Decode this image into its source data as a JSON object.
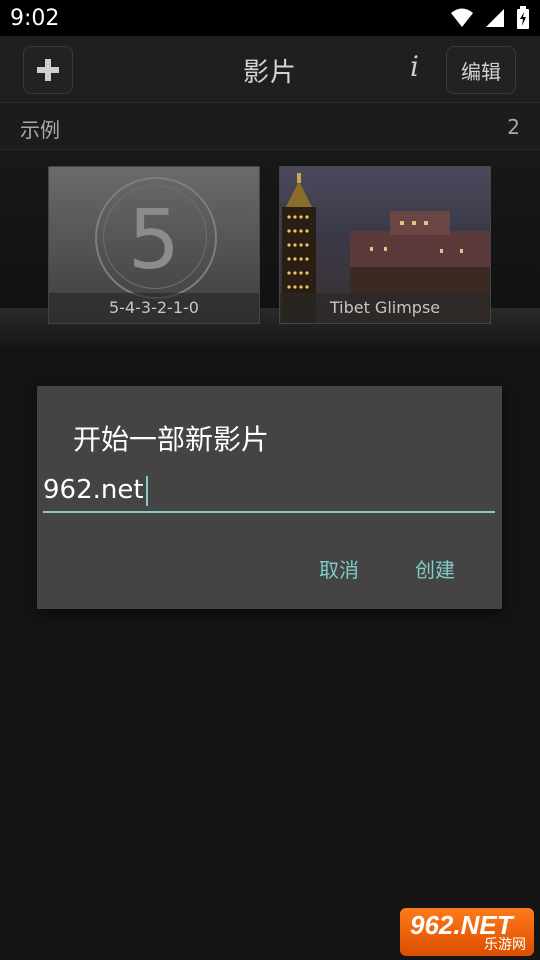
{
  "status_bar": {
    "time": "9:02"
  },
  "toolbar": {
    "title": "影片",
    "info_label": "i",
    "edit_label": "编辑"
  },
  "section": {
    "label": "示例",
    "count": "2"
  },
  "cards": [
    {
      "caption": "5-4-3-2-1-0",
      "number": "5"
    },
    {
      "caption": "Tibet Glimpse"
    }
  ],
  "dialog": {
    "title": "开始一部新影片",
    "input_value": "962.net",
    "cancel_label": "取消",
    "create_label": "创建"
  },
  "watermark": {
    "brand": "962.NET",
    "sub": "乐游网"
  },
  "colors": {
    "accent": "#80cbc4",
    "background": "#141414",
    "dialog": "#444444"
  }
}
